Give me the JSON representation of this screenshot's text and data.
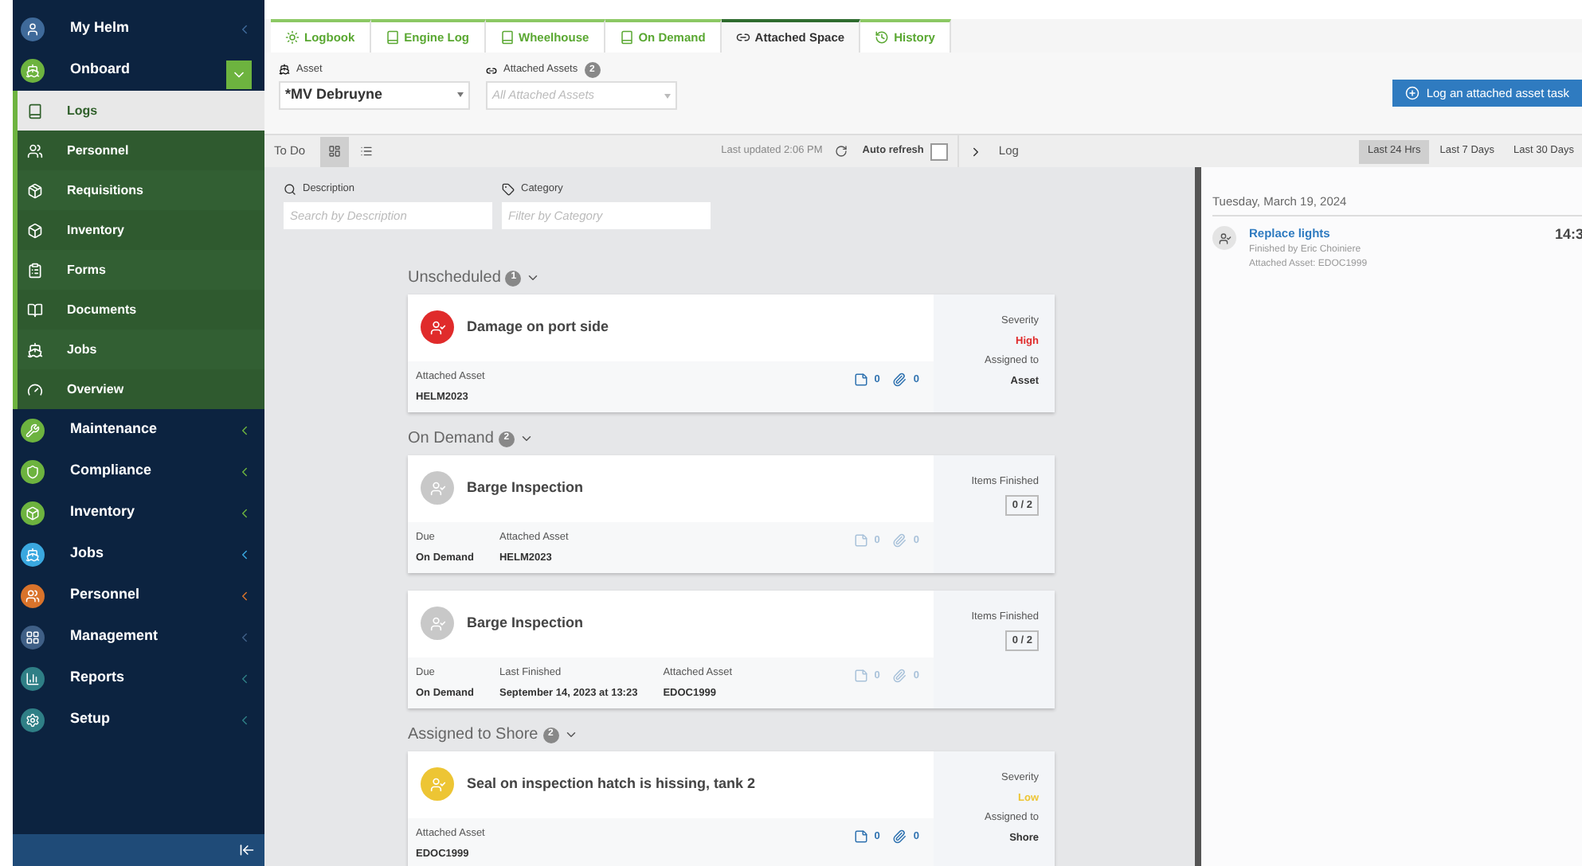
{
  "sidebar": {
    "items": [
      {
        "label": "My Helm",
        "color": "#3f6a9a",
        "expanded": false
      },
      {
        "label": "Onboard",
        "color": "#6db33f",
        "expanded": true,
        "children": [
          {
            "label": "Logs",
            "selected": true
          },
          {
            "label": "Personnel",
            "selected": false
          },
          {
            "label": "Requisitions",
            "selected": false
          },
          {
            "label": "Inventory",
            "selected": false
          },
          {
            "label": "Forms",
            "selected": false
          },
          {
            "label": "Documents",
            "selected": false
          },
          {
            "label": "Jobs",
            "selected": false
          },
          {
            "label": "Overview",
            "selected": false
          }
        ]
      },
      {
        "label": "Maintenance",
        "color": "#6db33f",
        "expanded": false
      },
      {
        "label": "Compliance",
        "color": "#6db33f",
        "expanded": false
      },
      {
        "label": "Inventory",
        "color": "#6db33f",
        "expanded": false
      },
      {
        "label": "Jobs",
        "color": "#3aa8e0",
        "expanded": false
      },
      {
        "label": "Personnel",
        "color": "#d9732b",
        "expanded": false
      },
      {
        "label": "Management",
        "color": "#3f5f86",
        "expanded": false
      },
      {
        "label": "Reports",
        "color": "#2f7f86",
        "expanded": false
      },
      {
        "label": "Setup",
        "color": "#2f7f86",
        "expanded": false
      }
    ]
  },
  "tabs": [
    {
      "label": "Logbook",
      "selected": false
    },
    {
      "label": "Engine Log",
      "selected": false
    },
    {
      "label": "Wheelhouse",
      "selected": false
    },
    {
      "label": "On Demand",
      "selected": false
    },
    {
      "label": "Attached Space",
      "selected": true
    },
    {
      "label": "History",
      "selected": false
    }
  ],
  "asset": {
    "label": "Asset",
    "value": "*MV Debruyne"
  },
  "attached_assets": {
    "label": "Attached Assets",
    "count": "2",
    "placeholder": "All Attached Assets"
  },
  "log_button": "Log an attached asset task",
  "toolbar": {
    "title": "To Do",
    "views": [
      {
        "kind": "grid",
        "selected": true
      },
      {
        "kind": "list",
        "selected": false
      }
    ],
    "last_updated": "Last updated 2:06 PM",
    "auto_refresh": {
      "label": "Auto refresh",
      "checked": false
    }
  },
  "filters": [
    {
      "label": "Description",
      "placeholder": "Search by Description"
    },
    {
      "label": "Category",
      "placeholder": "Filter by Category"
    }
  ],
  "groups": [
    {
      "title": "Unscheduled",
      "count": "1",
      "tasks": [
        {
          "kind": "severity",
          "title": "Damage on port side",
          "color": "#e02b2b",
          "muted": false,
          "fields": [
            {
              "label": "Attached Asset",
              "value": "HELM2023"
            }
          ],
          "notes": "0",
          "attachments": "0",
          "severity_label": "Severity",
          "severity": "High",
          "assigned_label": "Assigned to",
          "assigned": "Asset"
        }
      ]
    },
    {
      "title": "On Demand",
      "count": "2",
      "tasks": [
        {
          "kind": "items",
          "title": "Barge Inspection",
          "color": "#c8c8c8",
          "muted": true,
          "fields": [
            {
              "label": "Due",
              "value": "On Demand"
            },
            {
              "label": "Attached Asset",
              "value": "HELM2023"
            }
          ],
          "notes": "0",
          "attachments": "0",
          "items_label": "Items Finished",
          "items": "0 / 2"
        },
        {
          "kind": "items",
          "title": "Barge Inspection",
          "color": "#c8c8c8",
          "muted": true,
          "fields": [
            {
              "label": "Due",
              "value": "On Demand"
            },
            {
              "label": "Last Finished",
              "value": "September 14, 2023 at 13:23"
            },
            {
              "label": "Attached Asset",
              "value": "EDOC1999"
            }
          ],
          "notes": "0",
          "attachments": "0",
          "items_label": "Items Finished",
          "items": "0 / 2"
        }
      ]
    },
    {
      "title": "Assigned to Shore",
      "count": "2",
      "tasks": [
        {
          "kind": "severity",
          "title": "Seal on inspection hatch is hissing, tank 2",
          "color": "#edc534",
          "muted": false,
          "fields": [
            {
              "label": "Attached Asset",
              "value": "EDOC1999"
            }
          ],
          "notes": "0",
          "attachments": "0",
          "severity_label": "Severity",
          "severity": "Low",
          "assigned_label": "Assigned to",
          "assigned": "Shore"
        }
      ]
    }
  ],
  "log": {
    "title": "Log",
    "ranges": [
      {
        "label": "Last 24 Hrs",
        "selected": true
      },
      {
        "label": "Last 7 Days",
        "selected": false
      },
      {
        "label": "Last 30 Days",
        "selected": false
      }
    ],
    "date": "Tuesday, March 19, 2024",
    "entries": [
      {
        "title": "Replace lights",
        "finished_by": "Finished by Eric Choiniere",
        "attached_asset": "Attached Asset: EDOC1999",
        "time": "14:3"
      }
    ]
  }
}
